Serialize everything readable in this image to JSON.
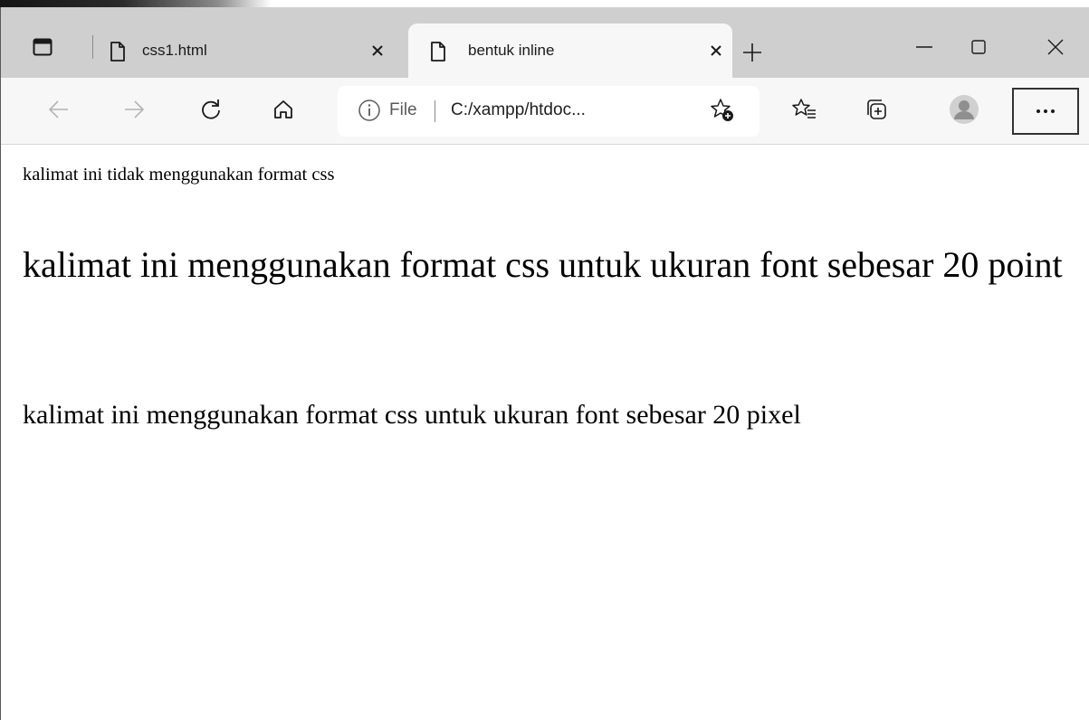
{
  "browser": {
    "tabs": [
      {
        "title": "css1.html",
        "active": false
      },
      {
        "title": "bentuk inline",
        "active": true
      }
    ],
    "address": {
      "scheme_label": "File",
      "url_display": "C:/xampp/htdoc..."
    },
    "icons": {
      "tab_actions": "tab-actions-icon",
      "page": "page-icon",
      "close": "close-icon",
      "new_tab": "plus-icon",
      "minimize": "minimize-icon",
      "maximize": "maximize-icon",
      "window_close": "window-close-icon",
      "back": "arrow-left-icon",
      "forward": "arrow-right-icon",
      "refresh": "refresh-icon",
      "home": "home-icon",
      "info": "info-icon",
      "add_favorite": "star-add-icon",
      "favorites": "favorites-icon",
      "collections": "collections-icon",
      "profile": "avatar-icon",
      "more": "more-icon"
    }
  },
  "page": {
    "lines": [
      "kalimat ini tidak menggunakan format css",
      "kalimat ini menggunakan format css untuk ukuran font sebesar 20 point",
      "kalimat ini menggunakan format css untuk ukuran font sebesar 20 pixel"
    ]
  }
}
